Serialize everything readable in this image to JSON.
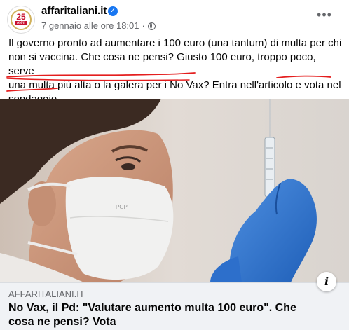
{
  "post": {
    "page_name": "affaritaliani.it",
    "avatar": {
      "number": "25",
      "caption": "ANNI"
    },
    "timestamp": "7 gennaio alle ore 18:01",
    "separator": "·",
    "text_lines": [
      "Il governo pronto ad aumentare i 100 euro (una tantum) di multa per chi",
      "non si vaccina. Che cosa ne pensi? Giusto 100 euro, troppo poco, serve",
      "una multa più alta o la galera per i No Vax? Entra nell'articolo e vota nel",
      "sondaggio"
    ],
    "annotation_color": "#e41e1e"
  },
  "link": {
    "domain": "AFFARITALIANI.IT",
    "headline_lines": [
      "No Vax, il Pd: \"Valutare aumento multa 100 euro\". Che",
      "cosa ne pensi? Vota"
    ]
  },
  "icons": {
    "verified": "verified-badge-icon",
    "audience": "globe-icon",
    "more": "more-options-icon",
    "info": "info-icon"
  },
  "colors": {
    "facebook_blue": "#1877f2",
    "secondary_text": "#65676b",
    "preview_background": "#f0f2f5"
  }
}
